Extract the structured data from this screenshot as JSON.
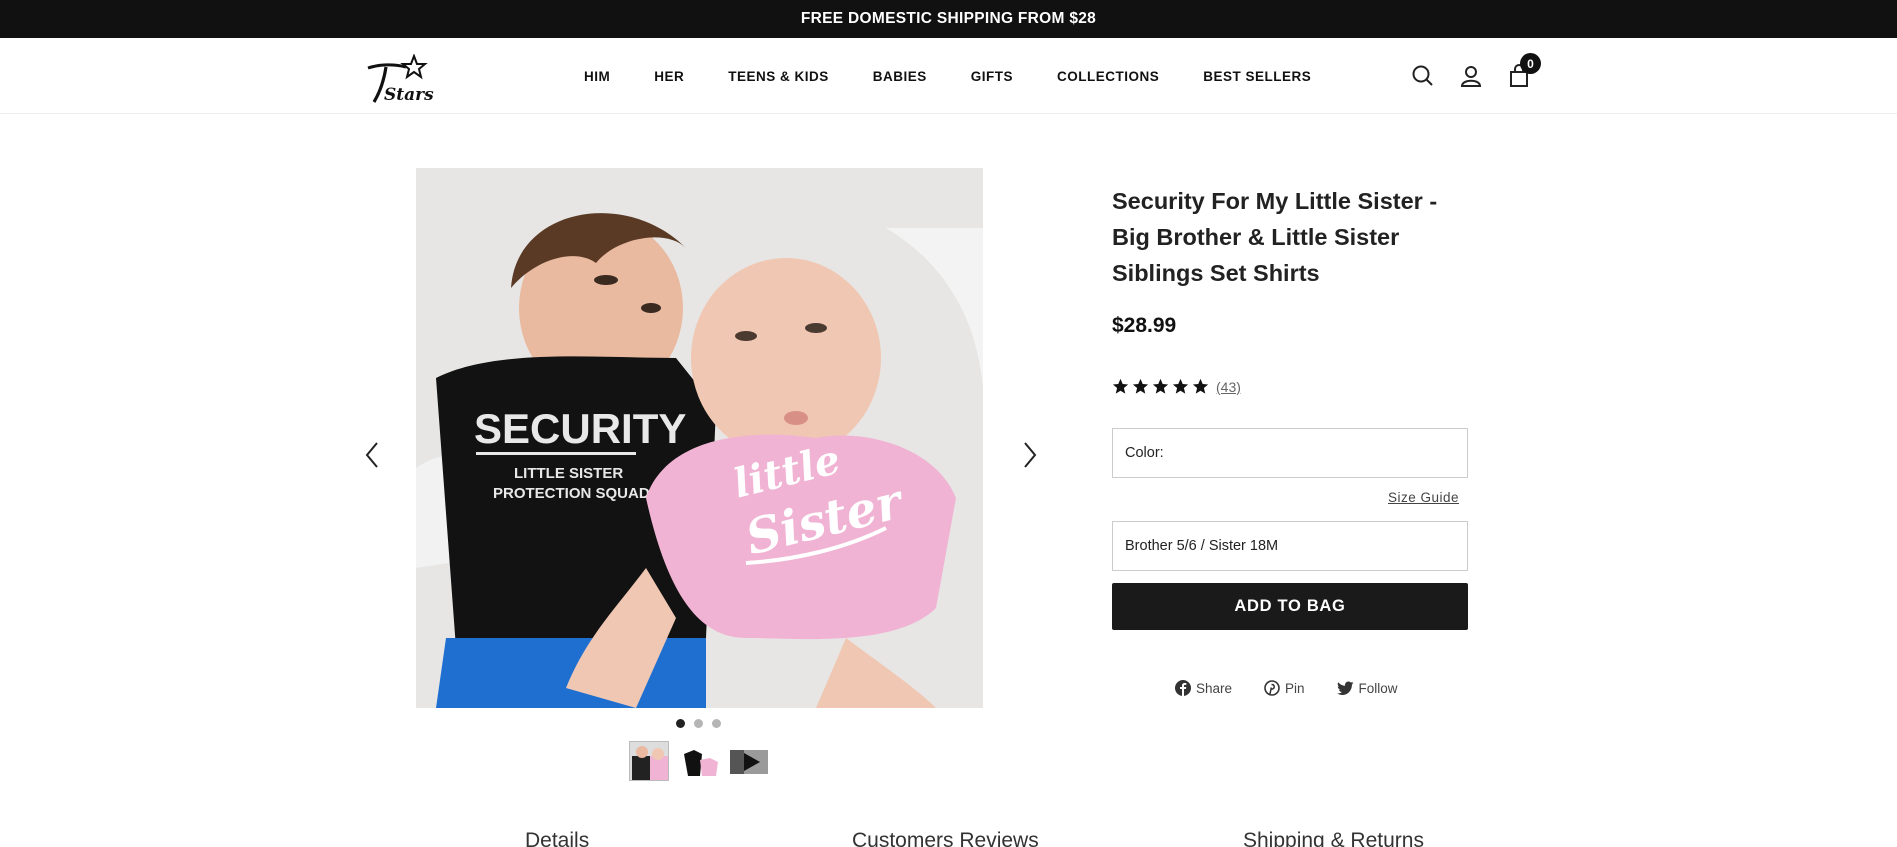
{
  "announcement": "FREE DOMESTIC SHIPPING FROM $28",
  "nav": {
    "items": [
      "HIM",
      "HER",
      "TEENS & KIDS",
      "BABIES",
      "GIFTS",
      "COLLECTIONS",
      "BEST SELLERS"
    ]
  },
  "header_icons": {
    "search": "search-icon",
    "account": "user-icon",
    "cart": "bag-icon",
    "cart_count": "0"
  },
  "gallery": {
    "image_text": {
      "security": "SECURITY",
      "line1": "LITTLE SISTER",
      "line2": "PROTECTION SQUAD",
      "little": "little",
      "sister": "Sister"
    },
    "dots": 3,
    "active_dot": 0
  },
  "product": {
    "title": "Security For My Little Sister - Big Brother & Little Sister Siblings Set Shirts",
    "price": "$28.99",
    "rating": 5,
    "reviews": "(43)",
    "color_label": "Color:",
    "size_guide": "Size Guide",
    "size_value": "Brother 5/6 / Sister 18M",
    "add_to_bag": "ADD TO BAG"
  },
  "share": {
    "share": "Share",
    "pin": "Pin",
    "follow": "Follow"
  },
  "tabs": [
    "Details",
    "Customers Reviews",
    "Shipping & Returns"
  ],
  "colors": {
    "dark": "#111111",
    "button": "#1a1a1a",
    "pink": "#f1b3d3"
  }
}
